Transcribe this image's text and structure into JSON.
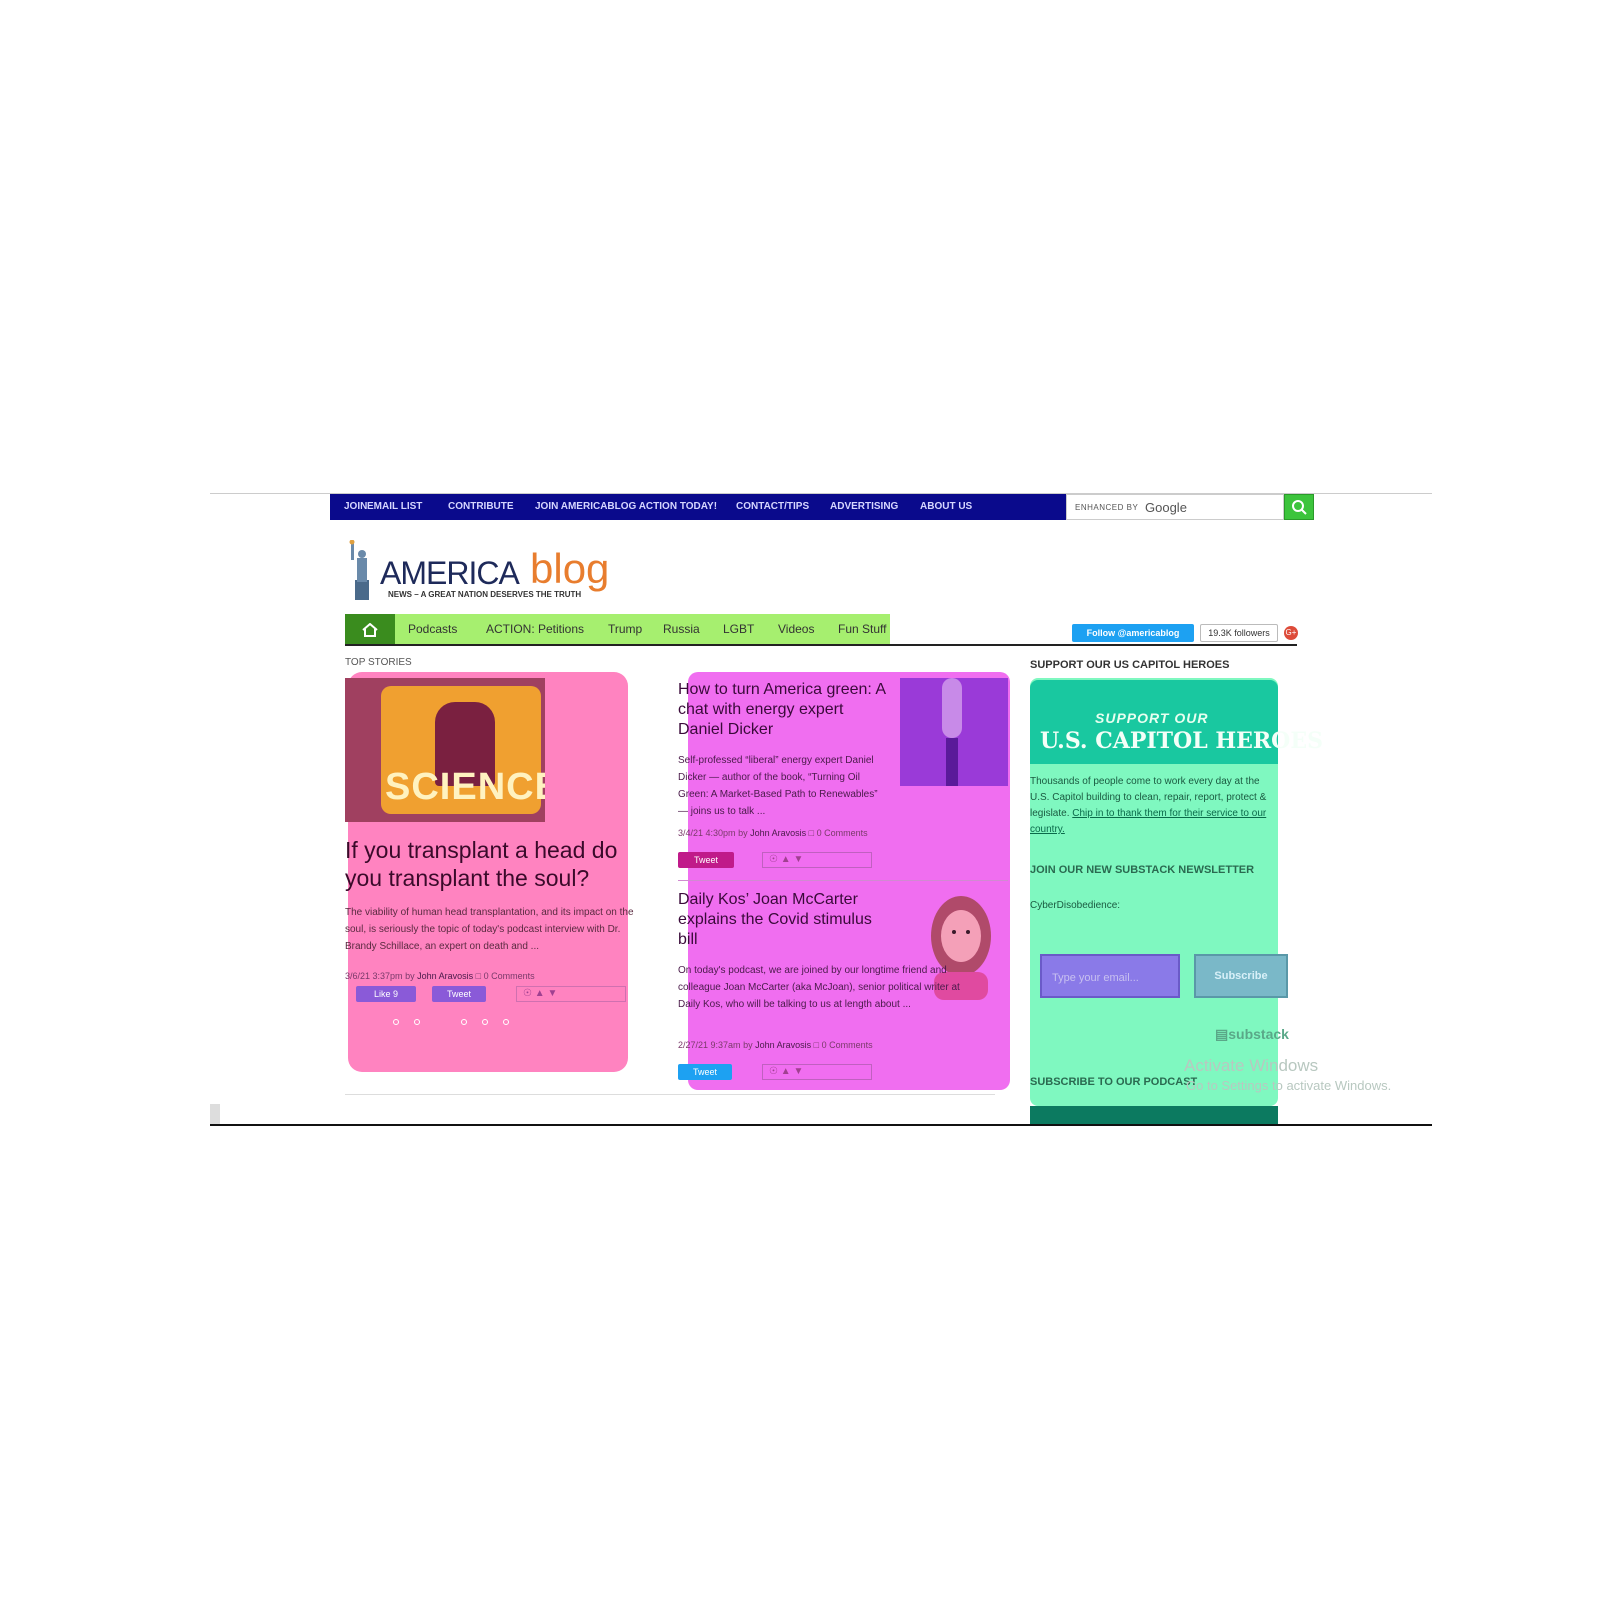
{
  "header": {
    "menu": [
      "JOIN",
      "EMAIL LIST",
      "CONTRIBUTE",
      "JOIN AMERICABLOG ACTION TODAY!",
      "CONTACT/TIPS",
      "ADVERTISING",
      "ABOUT US"
    ],
    "search": {
      "enhanced_by": "ENHANCED BY",
      "provider": "Google",
      "placeholder": ""
    }
  },
  "logo": {
    "part1": "AMERICA",
    "part2": "blog",
    "tagline": "NEWS – A GREAT NATION DESERVES THE TRUTH"
  },
  "nav": {
    "items": [
      "Podcasts",
      "ACTION: Petitions",
      "Trump",
      "Russia",
      "LGBT",
      "Videos",
      "Fun Stuff"
    ],
    "follow_label": "Follow @americablog",
    "followers": "19.3K followers",
    "gplus": "G+"
  },
  "main": {
    "section_label": "TOP STORIES",
    "lead": {
      "image_word": "SCIENCE!",
      "title": "If you transplant a head do you transplant the soul?",
      "excerpt": "The viability of human head transplantation, and its impact on the soul, is seriously the topic of today's podcast interview with Dr. Brandy Schillace, an expert on death and ...",
      "date": "3/6/21 3:37pm",
      "by": "by",
      "author": "John Aravosis",
      "comments": "0 Comments",
      "like_label": "Like 9",
      "tweet_label": "Tweet"
    },
    "stories": [
      {
        "title": "How to turn America green: A chat with energy expert Daniel Dicker",
        "excerpt": "Self-professed “liberal” energy expert Daniel Dicker — author of the book, “Turning Oil Green: A Market-Based Path to Renewables” — joins us to talk ...",
        "date": "3/4/21 4:30pm",
        "by": "by",
        "author": "John Aravosis",
        "comments": "0 Comments",
        "tweet_label": "Tweet"
      },
      {
        "title": "Daily Kos’ Joan McCarter explains the Covid stimulus bill",
        "excerpt": "On today's podcast, we are joined by our longtime friend and colleague Joan McCarter (aka McJoan), senior political writer at Daily Kos, who will be talking to us at length about ...",
        "date": "2/27/21 9:37am",
        "by": "by",
        "author": "John Aravosis",
        "comments": "0 Comments",
        "tweet_label": "Tweet"
      }
    ]
  },
  "sidebar": {
    "support_title": "SUPPORT OUR US CAPITOL HEROES",
    "banner_small": "SUPPORT OUR",
    "banner_big": "U.S. CAPITOL HEROES",
    "support_text": "Thousands of people come to work every day at the U.S. Capitol building to clean, repair, report, protect & legislate. ",
    "support_link": "Chip in to thank them for their service to our country.",
    "newsletter_title": "JOIN OUR NEW SUBSTACK NEWSLETTER",
    "newsletter_name": "CyberDisobedience:",
    "email_placeholder": "Type your email...",
    "subscribe_label": "Subscribe",
    "substack_brand": "substack",
    "podcast_title": "SUBSCRIBE TO OUR PODCAST"
  },
  "os_watermark": {
    "line1": "Activate Windows",
    "line2": "Go to Settings to activate Windows."
  },
  "colors": {
    "menu_bg": "#0a0a8c",
    "nav_bg": "#a6ef6f",
    "lead_card": "#ff83c0",
    "stories_card": "#f06ef0",
    "sidebar_card": "#7ff8c0",
    "twitter_blue": "#1da1f2",
    "logo_orange": "#e87d2e"
  }
}
